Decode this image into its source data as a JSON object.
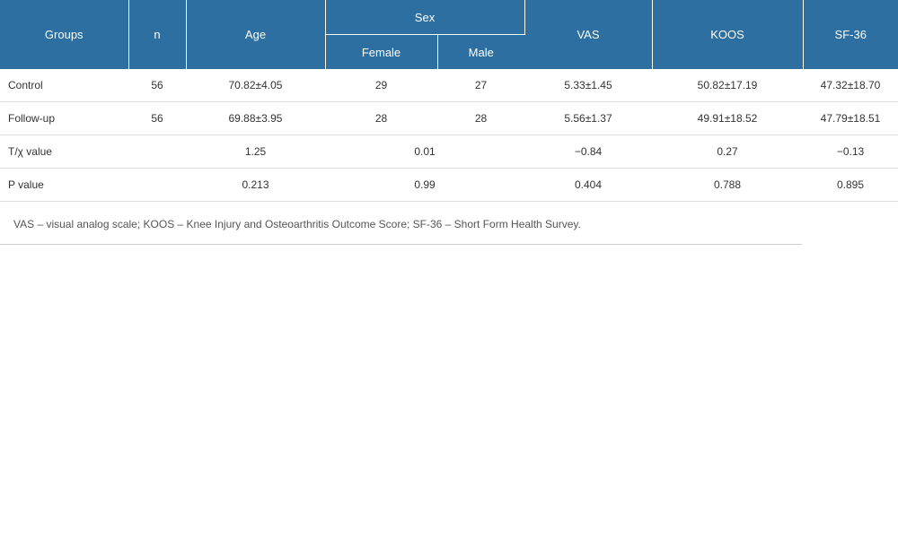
{
  "header": {
    "groups": "Groups",
    "n": "n",
    "age": "Age",
    "sex": "Sex",
    "female": "Female",
    "male": "Male",
    "vas": "VAS",
    "koos": "KOOS",
    "sf36": "SF-36"
  },
  "rows": [
    {
      "label": "Control",
      "n": "56",
      "age": "70.82±4.05",
      "female": "29",
      "male": "27",
      "vas": "5.33±1.45",
      "koos": "50.82±17.19",
      "sf36": "47.32±18.70"
    },
    {
      "label": "Follow-up",
      "n": "56",
      "age": "69.88±3.95",
      "female": "28",
      "male": "28",
      "vas": "5.56±1.37",
      "koos": "49.91±18.52",
      "sf36": "47.79±18.51"
    },
    {
      "label": "T/χ value",
      "age": "1.25",
      "sex": "0.01",
      "vas": "−0.84",
      "koos": "0.27",
      "sf36": "−0.13"
    },
    {
      "label": "P value",
      "age": "0.213",
      "sex": "0.99",
      "vas": "0.404",
      "koos": "0.788",
      "sf36": "0.895"
    }
  ],
  "footnote": "VAS – visual analog scale; KOOS – Knee Injury and Osteoarthritis Outcome Score; SF-36 – Short Form Health Survey.",
  "colors": {
    "header_bg": "#2d6fa0",
    "header_text": "#ffffff"
  }
}
